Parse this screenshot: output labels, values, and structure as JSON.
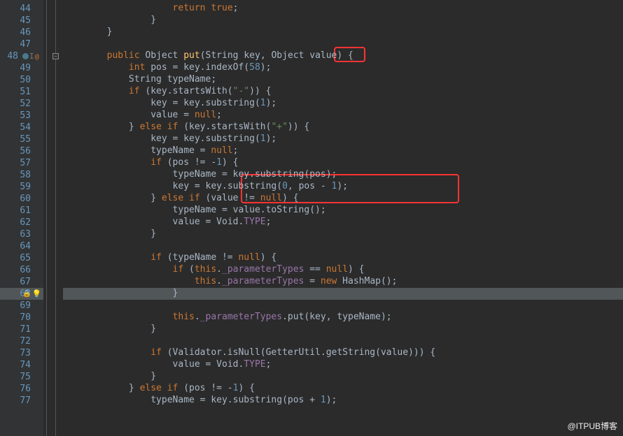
{
  "watermark": "@ITPUB博客",
  "lines": [
    {
      "n": 44,
      "indent": 20,
      "tokens": [
        {
          "c": "kw",
          "t": "return"
        },
        {
          "c": "id",
          "t": " "
        },
        {
          "c": "kw",
          "t": "true"
        },
        {
          "c": "id",
          "t": ";"
        }
      ]
    },
    {
      "n": 45,
      "indent": 16,
      "tokens": [
        {
          "c": "id",
          "t": "}"
        }
      ]
    },
    {
      "n": 46,
      "indent": 8,
      "tokens": [
        {
          "c": "id",
          "t": "}"
        }
      ]
    },
    {
      "n": 47,
      "indent": 0,
      "tokens": []
    },
    {
      "n": 48,
      "indent": 8,
      "gutter": "override",
      "fold": "-",
      "tokens": [
        {
          "c": "kw",
          "t": "public"
        },
        {
          "c": "id",
          "t": " Object "
        },
        {
          "c": "mth",
          "t": "put"
        },
        {
          "c": "id",
          "t": "(String "
        },
        {
          "c": "id",
          "t": "key"
        },
        {
          "c": "id",
          "t": ", Object value) {"
        }
      ]
    },
    {
      "n": 49,
      "indent": 12,
      "tokens": [
        {
          "c": "kw",
          "t": "int"
        },
        {
          "c": "id",
          "t": " pos = key.indexOf("
        },
        {
          "c": "num",
          "t": "58"
        },
        {
          "c": "id",
          "t": ");"
        }
      ]
    },
    {
      "n": 50,
      "indent": 12,
      "tokens": [
        {
          "c": "id",
          "t": "String typeName;"
        }
      ]
    },
    {
      "n": 51,
      "indent": 12,
      "tokens": [
        {
          "c": "kw",
          "t": "if"
        },
        {
          "c": "id",
          "t": " (key.startsWith("
        },
        {
          "c": "str",
          "t": "\"-\""
        },
        {
          "c": "id",
          "t": ")) {"
        }
      ]
    },
    {
      "n": 52,
      "indent": 16,
      "tokens": [
        {
          "c": "id",
          "t": "key = key.substring("
        },
        {
          "c": "num",
          "t": "1"
        },
        {
          "c": "id",
          "t": ");"
        }
      ]
    },
    {
      "n": 53,
      "indent": 16,
      "tokens": [
        {
          "c": "id",
          "t": "value = "
        },
        {
          "c": "kw",
          "t": "null"
        },
        {
          "c": "id",
          "t": ";"
        }
      ]
    },
    {
      "n": 54,
      "indent": 12,
      "tokens": [
        {
          "c": "id",
          "t": "} "
        },
        {
          "c": "kw",
          "t": "else if"
        },
        {
          "c": "id",
          "t": " (key.startsWith("
        },
        {
          "c": "str",
          "t": "\"+\""
        },
        {
          "c": "id",
          "t": ")) {"
        }
      ]
    },
    {
      "n": 55,
      "indent": 16,
      "tokens": [
        {
          "c": "id",
          "t": "key = key.substring("
        },
        {
          "c": "num",
          "t": "1"
        },
        {
          "c": "id",
          "t": ");"
        }
      ]
    },
    {
      "n": 56,
      "indent": 16,
      "tokens": [
        {
          "c": "id",
          "t": "typeName = "
        },
        {
          "c": "kw",
          "t": "null"
        },
        {
          "c": "id",
          "t": ";"
        }
      ]
    },
    {
      "n": 57,
      "indent": 16,
      "tokens": [
        {
          "c": "kw",
          "t": "if"
        },
        {
          "c": "id",
          "t": " (pos != -"
        },
        {
          "c": "num",
          "t": "1"
        },
        {
          "c": "id",
          "t": ") {"
        }
      ]
    },
    {
      "n": 58,
      "indent": 20,
      "tokens": [
        {
          "c": "id",
          "t": "typeName = key.substring(pos);"
        }
      ]
    },
    {
      "n": 59,
      "indent": 20,
      "tokens": [
        {
          "c": "id",
          "t": "key = key.substring("
        },
        {
          "c": "num",
          "t": "0"
        },
        {
          "c": "id",
          "t": ", pos - "
        },
        {
          "c": "num",
          "t": "1"
        },
        {
          "c": "id",
          "t": ");"
        }
      ]
    },
    {
      "n": 60,
      "indent": 16,
      "tokens": [
        {
          "c": "id",
          "t": "} "
        },
        {
          "c": "kw",
          "t": "else if"
        },
        {
          "c": "id",
          "t": " (value != "
        },
        {
          "c": "kw",
          "t": "null"
        },
        {
          "c": "id",
          "t": ") {"
        }
      ]
    },
    {
      "n": 61,
      "indent": 20,
      "tokens": [
        {
          "c": "id",
          "t": "typeName = value.toString();"
        }
      ]
    },
    {
      "n": 62,
      "indent": 20,
      "tokens": [
        {
          "c": "id",
          "t": "value = Void."
        },
        {
          "c": "fld",
          "t": "TYPE"
        },
        {
          "c": "id",
          "t": ";"
        }
      ]
    },
    {
      "n": 63,
      "indent": 16,
      "tokens": [
        {
          "c": "id",
          "t": "}"
        }
      ]
    },
    {
      "n": 64,
      "indent": 0,
      "tokens": []
    },
    {
      "n": 65,
      "indent": 16,
      "tokens": [
        {
          "c": "kw",
          "t": "if"
        },
        {
          "c": "id",
          "t": " (typeName != "
        },
        {
          "c": "kw",
          "t": "null"
        },
        {
          "c": "id",
          "t": ") {"
        }
      ]
    },
    {
      "n": 66,
      "indent": 20,
      "tokens": [
        {
          "c": "kw",
          "t": "if"
        },
        {
          "c": "id",
          "t": " ("
        },
        {
          "c": "kw",
          "t": "this"
        },
        {
          "c": "id",
          "t": "."
        },
        {
          "c": "fld",
          "t": "_parameterTypes"
        },
        {
          "c": "id",
          "t": " == "
        },
        {
          "c": "kw",
          "t": "null"
        },
        {
          "c": "id",
          "t": ") {"
        }
      ]
    },
    {
      "n": 67,
      "indent": 24,
      "tokens": [
        {
          "c": "kw",
          "t": "this"
        },
        {
          "c": "id",
          "t": "."
        },
        {
          "c": "fld",
          "t": "_parameterTypes"
        },
        {
          "c": "id",
          "t": " = "
        },
        {
          "c": "kw",
          "t": "new"
        },
        {
          "c": "id",
          "t": " HashMap();"
        }
      ]
    },
    {
      "n": 68,
      "indent": 20,
      "gutter": "bulb",
      "highlighted": true,
      "tokens": [
        {
          "c": "id",
          "t": "}"
        }
      ]
    },
    {
      "n": 69,
      "indent": 0,
      "tokens": []
    },
    {
      "n": 70,
      "indent": 20,
      "tokens": [
        {
          "c": "kw",
          "t": "this"
        },
        {
          "c": "id",
          "t": "."
        },
        {
          "c": "fld",
          "t": "_parameterTypes"
        },
        {
          "c": "id",
          "t": ".put(key, typeName);"
        }
      ]
    },
    {
      "n": 71,
      "indent": 16,
      "tokens": [
        {
          "c": "id",
          "t": "}"
        }
      ]
    },
    {
      "n": 72,
      "indent": 0,
      "tokens": []
    },
    {
      "n": 73,
      "indent": 16,
      "tokens": [
        {
          "c": "kw",
          "t": "if"
        },
        {
          "c": "id",
          "t": " (Validator.isNull(GetterUtil.getString(value))) {"
        }
      ]
    },
    {
      "n": 74,
      "indent": 20,
      "tokens": [
        {
          "c": "id",
          "t": "value = Void."
        },
        {
          "c": "fld",
          "t": "TYPE"
        },
        {
          "c": "id",
          "t": ";"
        }
      ]
    },
    {
      "n": 75,
      "indent": 16,
      "tokens": [
        {
          "c": "id",
          "t": "}"
        }
      ]
    },
    {
      "n": 76,
      "indent": 12,
      "tokens": [
        {
          "c": "id",
          "t": "} "
        },
        {
          "c": "kw",
          "t": "else if"
        },
        {
          "c": "id",
          "t": " (pos != -"
        },
        {
          "c": "num",
          "t": "1"
        },
        {
          "c": "id",
          "t": ") {"
        }
      ]
    },
    {
      "n": 77,
      "indent": 16,
      "tokens": [
        {
          "c": "id",
          "t": "typeName = key.substring(pos + "
        },
        {
          "c": "num",
          "t": "1"
        },
        {
          "c": "id",
          "t": ");"
        }
      ]
    }
  ]
}
